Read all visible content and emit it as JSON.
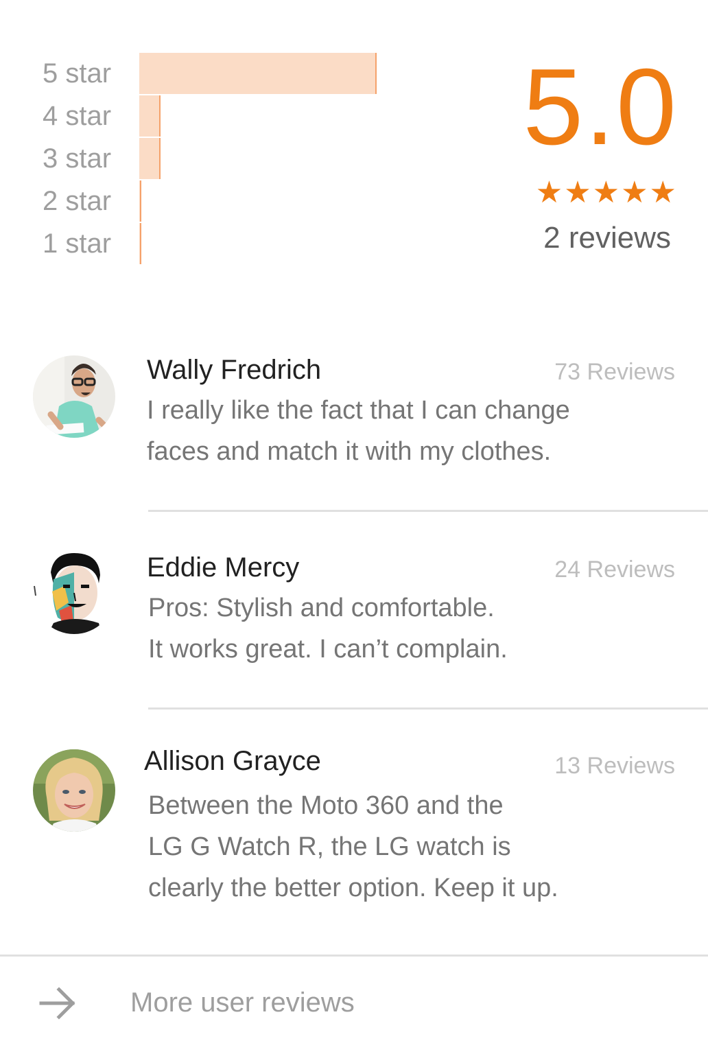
{
  "rating": {
    "average": "5.0",
    "stars": "★★★★★",
    "reviews_label": "2 reviews",
    "accent_color": "#ef7d13",
    "bar_color": "#fbdcc6",
    "histogram": [
      {
        "label": "5 star",
        "fraction": 1.0
      },
      {
        "label": "4 star",
        "fraction": 0.09
      },
      {
        "label": "3 star",
        "fraction": 0.09
      },
      {
        "label": "2 star",
        "fraction": 0.01
      },
      {
        "label": "1 star",
        "fraction": 0.01
      }
    ]
  },
  "reviews": [
    {
      "name": "Wally Fredrich",
      "count": "73 Reviews",
      "lines": [
        "I really like the fact that I can change",
        "faces and match it with my clothes."
      ],
      "avatar_icon": "avatar-photo"
    },
    {
      "name": "Eddie Mercy",
      "count": "24 Reviews",
      "lines": [
        "Pros: Stylish and comfortable.",
        "It works great. I can’t complain."
      ],
      "avatar_icon": "avatar-illustration"
    },
    {
      "name": "Allison Grayce",
      "count": "13 Reviews",
      "lines": [
        "Between the Moto 360 and the",
        "LG G Watch R, the LG watch is",
        "clearly the better option. Keep it up."
      ],
      "avatar_icon": "avatar-photo"
    }
  ],
  "more": {
    "label": "More user reviews",
    "icon": "arrow-right-icon"
  }
}
